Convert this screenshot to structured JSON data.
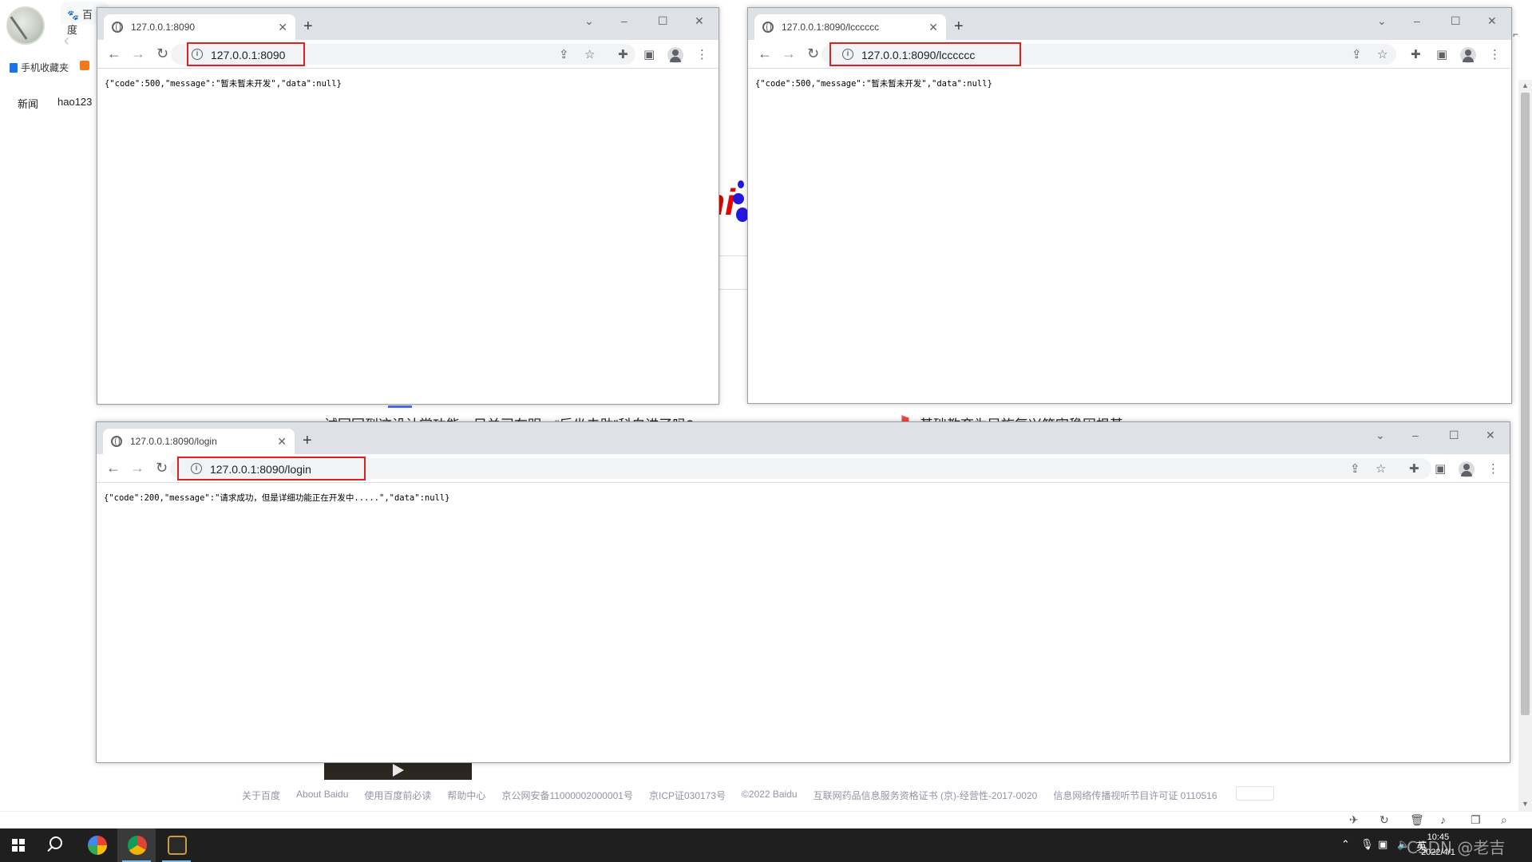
{
  "background_browser": {
    "tab_label": "百度",
    "favorites": [
      {
        "label": "手机收藏夹"
      }
    ],
    "nav_links": [
      "新闻",
      "hao123"
    ],
    "logo_text": "ni",
    "hot_left": "试回回到这设计常功能，目关司在明，“后坐未助”科白进了吗?",
    "hot_right": "基础教育为民族复兴筑牢稳固根基",
    "footer_links": [
      "关于百度",
      "About Baidu",
      "使用百度前必读",
      "帮助中心",
      "京公网安备11000002000001号",
      "京ICP证030173号",
      "©2022 Baidu",
      "互联网药品信息服务资格证书 (京)-经营性-2017-0020",
      "信息网络传播视听节目许可证 0110516"
    ]
  },
  "windows": [
    {
      "id": "window-1",
      "tab_title": "127.0.0.1:8090",
      "url": "127.0.0.1:8090",
      "body": "{\"code\":500,\"message\":\"暂未暂未开发\",\"data\":null}"
    },
    {
      "id": "window-2",
      "tab_title": "127.0.0.1:8090/lcccccc",
      "url": "127.0.0.1:8090/lcccccc",
      "body": "{\"code\":500,\"message\":\"暂未暂未开发\",\"data\":null}"
    },
    {
      "id": "window-3",
      "tab_title": "127.0.0.1:8090/login",
      "url": "127.0.0.1:8090/login",
      "body": "{\"code\":200,\"message\":\"请求成功，但是详细功能正在开发中.....\",\"data\":null}"
    }
  ],
  "taskbar": {
    "clock_time": "10:45",
    "clock_date": "2022/4/1",
    "ime": "英",
    "watermark": "CSDN @老吉"
  },
  "colors": {
    "highlight_box": "#e02020",
    "taskbar": "#1f1f1f",
    "baidu_red": "#e10602",
    "baidu_blue": "#2319dc"
  },
  "icons": [
    "back-arrow-icon",
    "forward-arrow-icon",
    "reload-icon",
    "info-icon",
    "share-icon",
    "star-icon",
    "extensions-icon",
    "side-panel-icon",
    "profile-icon",
    "menu-icon",
    "windows-start-icon",
    "search-icon",
    "chrome-icon"
  ]
}
